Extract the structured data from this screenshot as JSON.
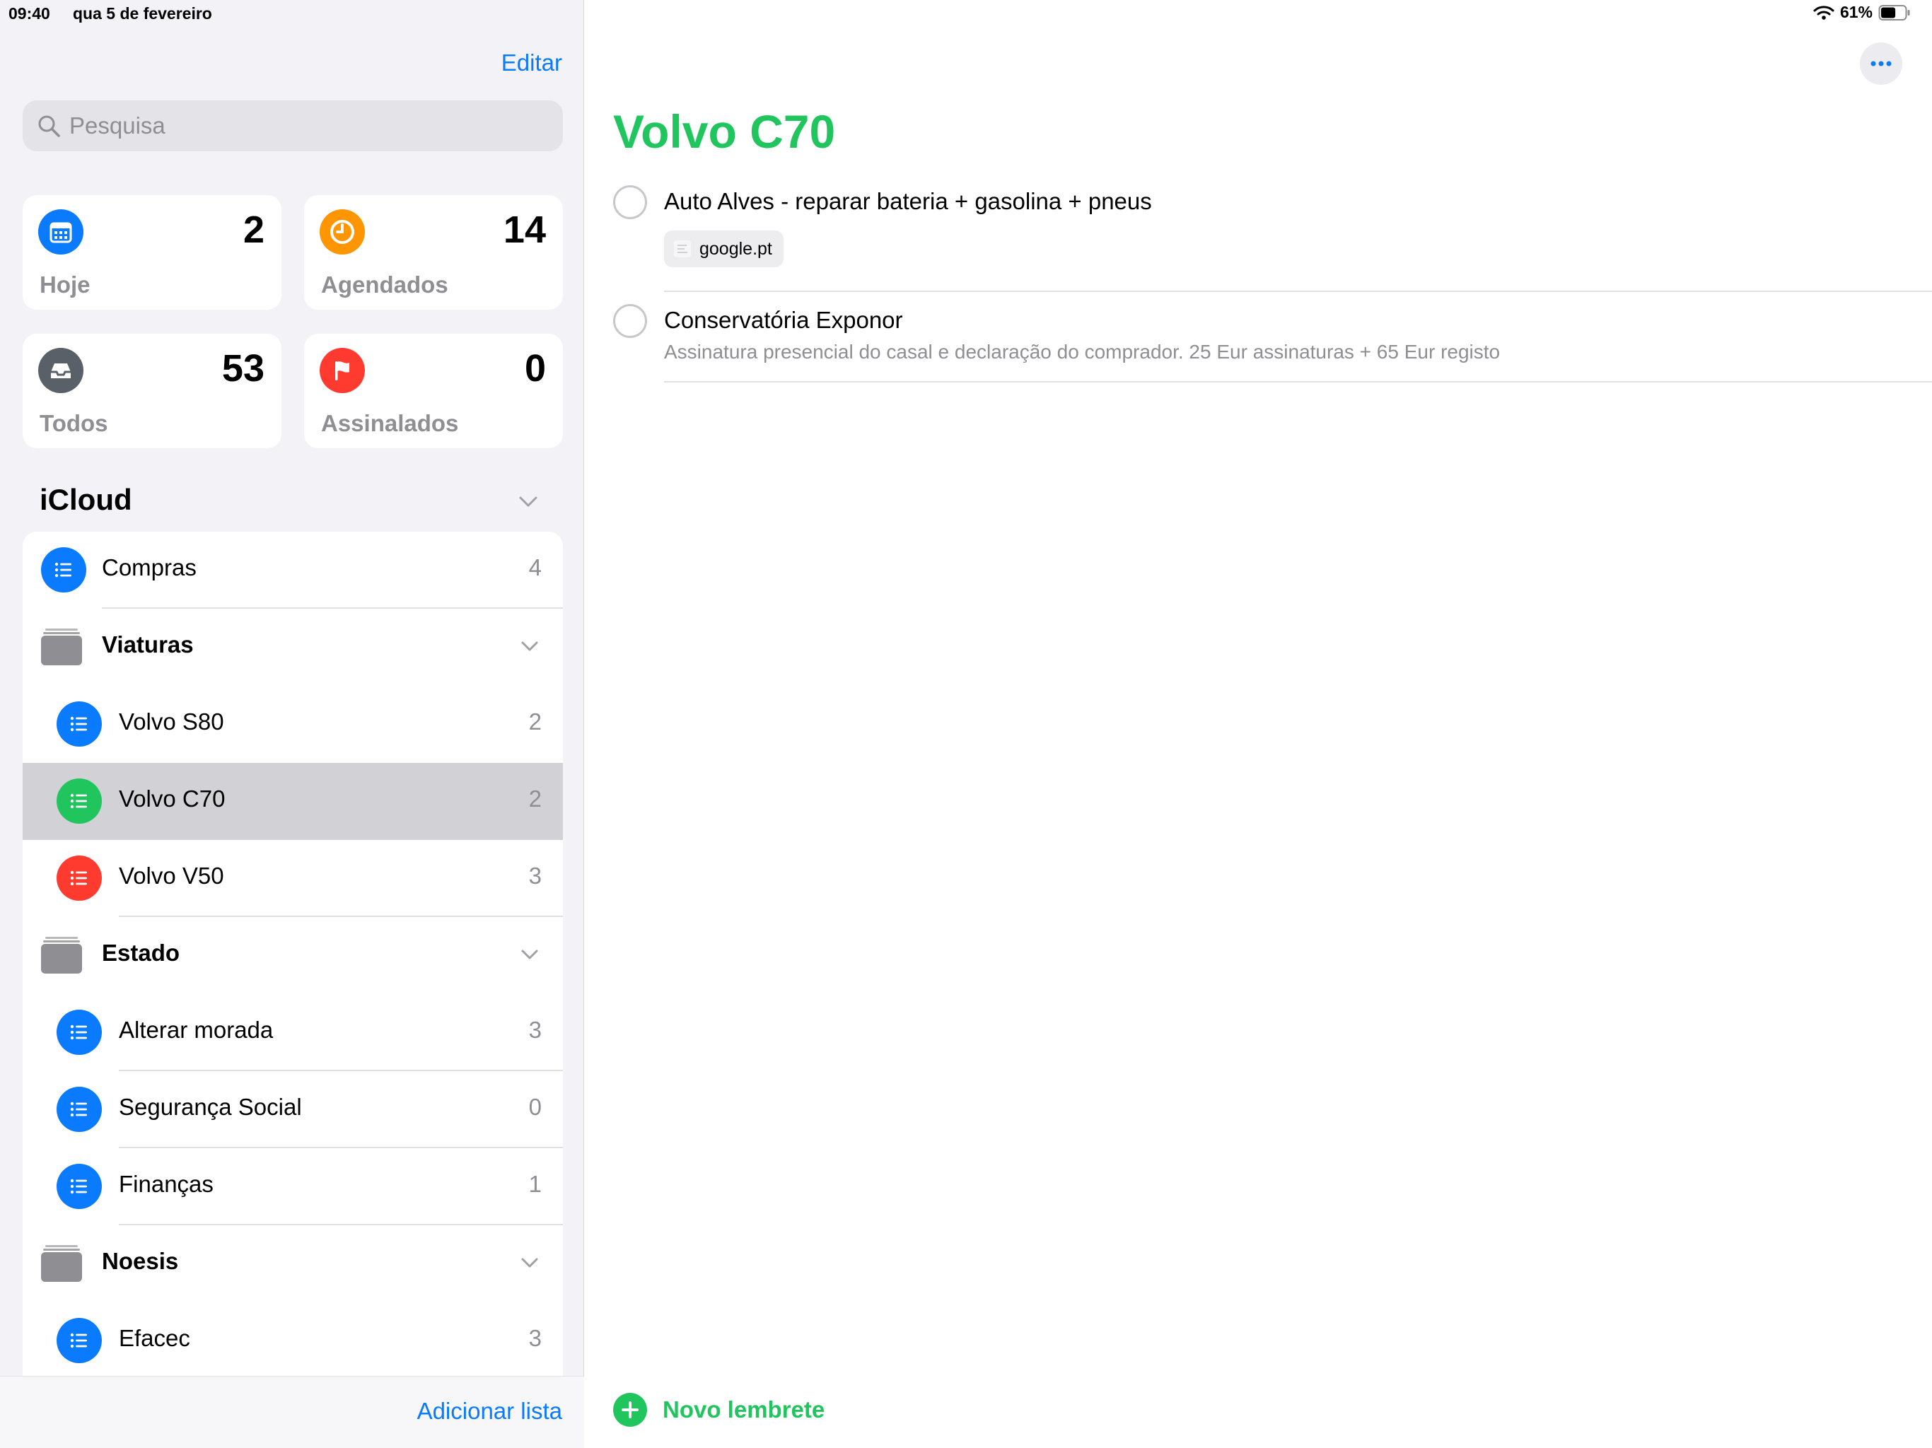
{
  "status": {
    "time": "09:40",
    "date": "qua 5 de fevereiro",
    "battery_percent": "61%",
    "battery_level": 0.61
  },
  "sidebar": {
    "edit_label": "Editar",
    "search_placeholder": "Pesquisa",
    "smart_lists": [
      {
        "label": "Hoje",
        "count": "2",
        "icon": "calendar-icon",
        "color": "#0a7aff"
      },
      {
        "label": "Agendados",
        "count": "14",
        "icon": "clock-icon",
        "color": "#ff9500"
      },
      {
        "label": "Todos",
        "count": "53",
        "icon": "tray-icon",
        "color": "#5a6068"
      },
      {
        "label": "Assinalados",
        "count": "0",
        "icon": "flag-icon",
        "color": "#ff3b30"
      }
    ],
    "section_title": "iCloud",
    "lists": [
      {
        "type": "list",
        "name": "Compras",
        "count": "4",
        "color": "#0a7aff"
      },
      {
        "type": "group",
        "name": "Viaturas"
      },
      {
        "type": "list",
        "name": "Volvo S80",
        "count": "2",
        "color": "#0a7aff",
        "indent": true
      },
      {
        "type": "list",
        "name": "Volvo C70",
        "count": "2",
        "color": "#21c55d",
        "indent": true,
        "selected": true
      },
      {
        "type": "list",
        "name": "Volvo V50",
        "count": "3",
        "color": "#ff3b30",
        "indent": true
      },
      {
        "type": "group",
        "name": "Estado"
      },
      {
        "type": "list",
        "name": "Alterar morada",
        "count": "3",
        "color": "#0a7aff",
        "indent": true
      },
      {
        "type": "list",
        "name": "Segurança Social",
        "count": "0",
        "color": "#0a7aff",
        "indent": true
      },
      {
        "type": "list",
        "name": "Finanças",
        "count": "1",
        "color": "#0a7aff",
        "indent": true
      },
      {
        "type": "group",
        "name": "Noesis"
      },
      {
        "type": "list",
        "name": "Efacec",
        "count": "3",
        "color": "#0a7aff",
        "indent": true
      }
    ],
    "add_list_label": "Adicionar lista"
  },
  "main": {
    "list_title": "Volvo C70",
    "accent_color": "#21c55d",
    "reminders": [
      {
        "title": "Auto Alves - reparar bateria + gasolina + pneus",
        "link": "google.pt"
      },
      {
        "title": "Conservatória Exponor",
        "notes": "Assinatura presencial do casal e declaração do comprador. 25 Eur assinaturas + 65 Eur registo"
      }
    ],
    "new_reminder_label": "Novo lembrete"
  }
}
